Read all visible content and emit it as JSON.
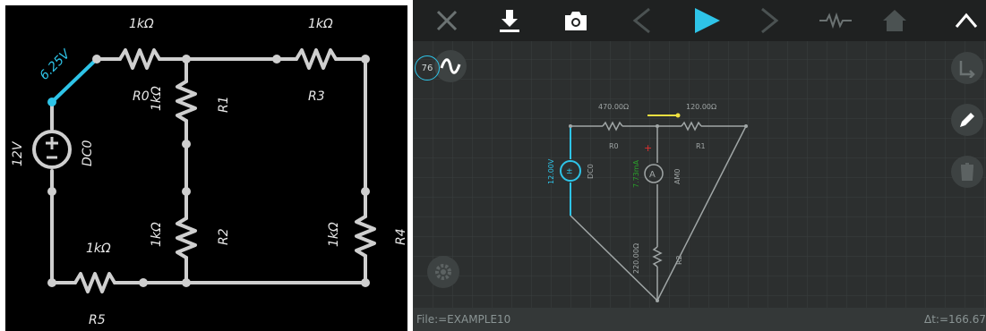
{
  "left_circuit": {
    "voltage_source": {
      "value": "12V",
      "name": "DC0"
    },
    "switch_value": "6.25V",
    "resistors": [
      {
        "value": "1kΩ",
        "name": "R0"
      },
      {
        "value": "1kΩ",
        "name": "R1"
      },
      {
        "value": "1kΩ",
        "name": "R2"
      },
      {
        "value": "1kΩ",
        "name": "R3"
      },
      {
        "value": "1kΩ",
        "name": "R4"
      },
      {
        "value": "1kΩ",
        "name": "R5"
      }
    ]
  },
  "toolbar": {
    "icons": [
      "close-icon",
      "download-icon",
      "camera-icon",
      "back-icon",
      "play-icon",
      "forward-icon",
      "resistor-icon",
      "home-icon",
      "collapse-icon"
    ]
  },
  "right_circuit": {
    "voltage_source": {
      "value": "12.00V",
      "name": "DC0"
    },
    "ammeter": {
      "value": "7.73mA",
      "name": "AM0"
    },
    "resistors": [
      {
        "value": "470.00Ω",
        "name": "R0"
      },
      {
        "value": "120.00Ω",
        "name": "R1"
      },
      {
        "value": "220.00Ω",
        "name": "R2"
      }
    ]
  },
  "speed_badge": "76",
  "status_bar": {
    "file": "File:=EXAMPLE10",
    "dt": "Δt:=166.67"
  },
  "colors": {
    "accent": "#2ec4e8",
    "wire": "#cfcfcf",
    "grid_wire": "#a0a6a6",
    "ammeter_text": "#2aa02a",
    "switch": "#f0e040"
  }
}
